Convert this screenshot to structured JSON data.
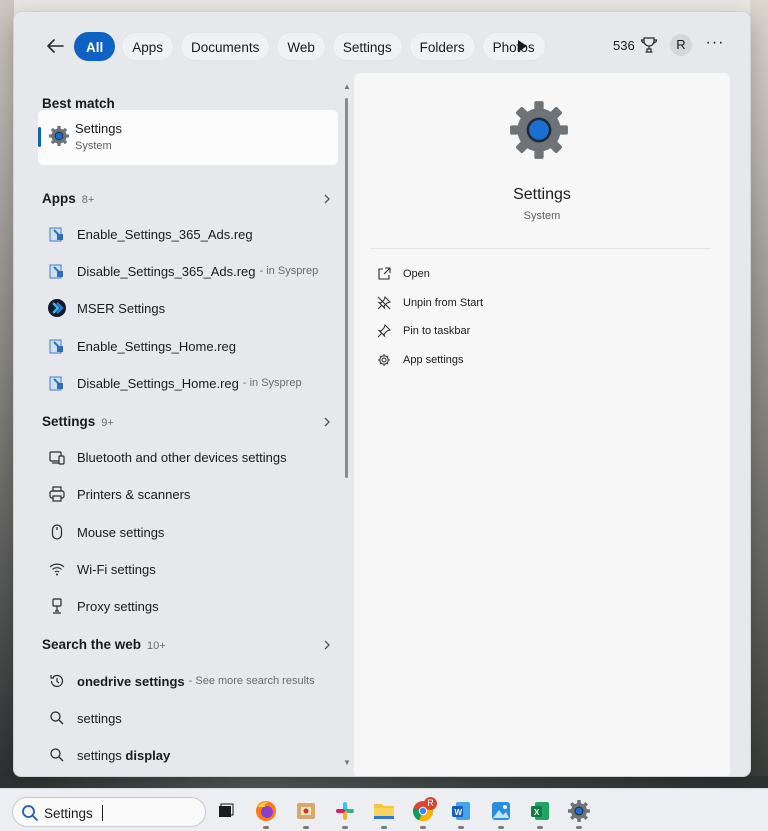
{
  "filters": {
    "tabs": [
      "All",
      "Apps",
      "Documents",
      "Web",
      "Settings",
      "Folders",
      "Photos"
    ],
    "active": "All"
  },
  "header": {
    "points": "536",
    "avatar_initial": "R"
  },
  "best_match": {
    "heading": "Best match",
    "title": "Settings",
    "subtitle": "System"
  },
  "apps_section": {
    "heading": "Apps",
    "count": "8+",
    "items": [
      {
        "label": "Enable_Settings_365_Ads.reg",
        "suffix": ""
      },
      {
        "label": "Disable_Settings_365_Ads.reg",
        "suffix": "- in Sysprep"
      },
      {
        "label": "MSER Settings",
        "suffix": ""
      },
      {
        "label": "Enable_Settings_Home.reg",
        "suffix": ""
      },
      {
        "label": "Disable_Settings_Home.reg",
        "suffix": "- in Sysprep"
      }
    ]
  },
  "settings_section": {
    "heading": "Settings",
    "count": "9+",
    "items": [
      {
        "label": "Bluetooth and other devices settings"
      },
      {
        "label": "Printers & scanners"
      },
      {
        "label": "Mouse settings"
      },
      {
        "label": "Wi-Fi settings"
      },
      {
        "label": "Proxy settings"
      }
    ]
  },
  "web_section": {
    "heading": "Search the web",
    "count": "10+",
    "items": [
      {
        "bold": "onedrive settings",
        "plain": "",
        "suffix": "- See more search results"
      },
      {
        "bold": "",
        "plain": "settings",
        "suffix": ""
      },
      {
        "bold": "display",
        "plain": "settings ",
        "suffix": ""
      }
    ]
  },
  "preview": {
    "title": "Settings",
    "subtitle": "System",
    "actions": [
      "Open",
      "Unpin from Start",
      "Pin to taskbar",
      "App settings"
    ]
  },
  "taskbar": {
    "search_value": "Settings",
    "apps": [
      "task-view",
      "firefox",
      "app-packager",
      "slack",
      "file-explorer",
      "chrome",
      "word",
      "photos",
      "excel",
      "settings"
    ],
    "chrome_badge": "R"
  },
  "colors": {
    "accent": "#0f62c4",
    "panel": "#e6e8ec",
    "preview": "#f7f7f8"
  }
}
